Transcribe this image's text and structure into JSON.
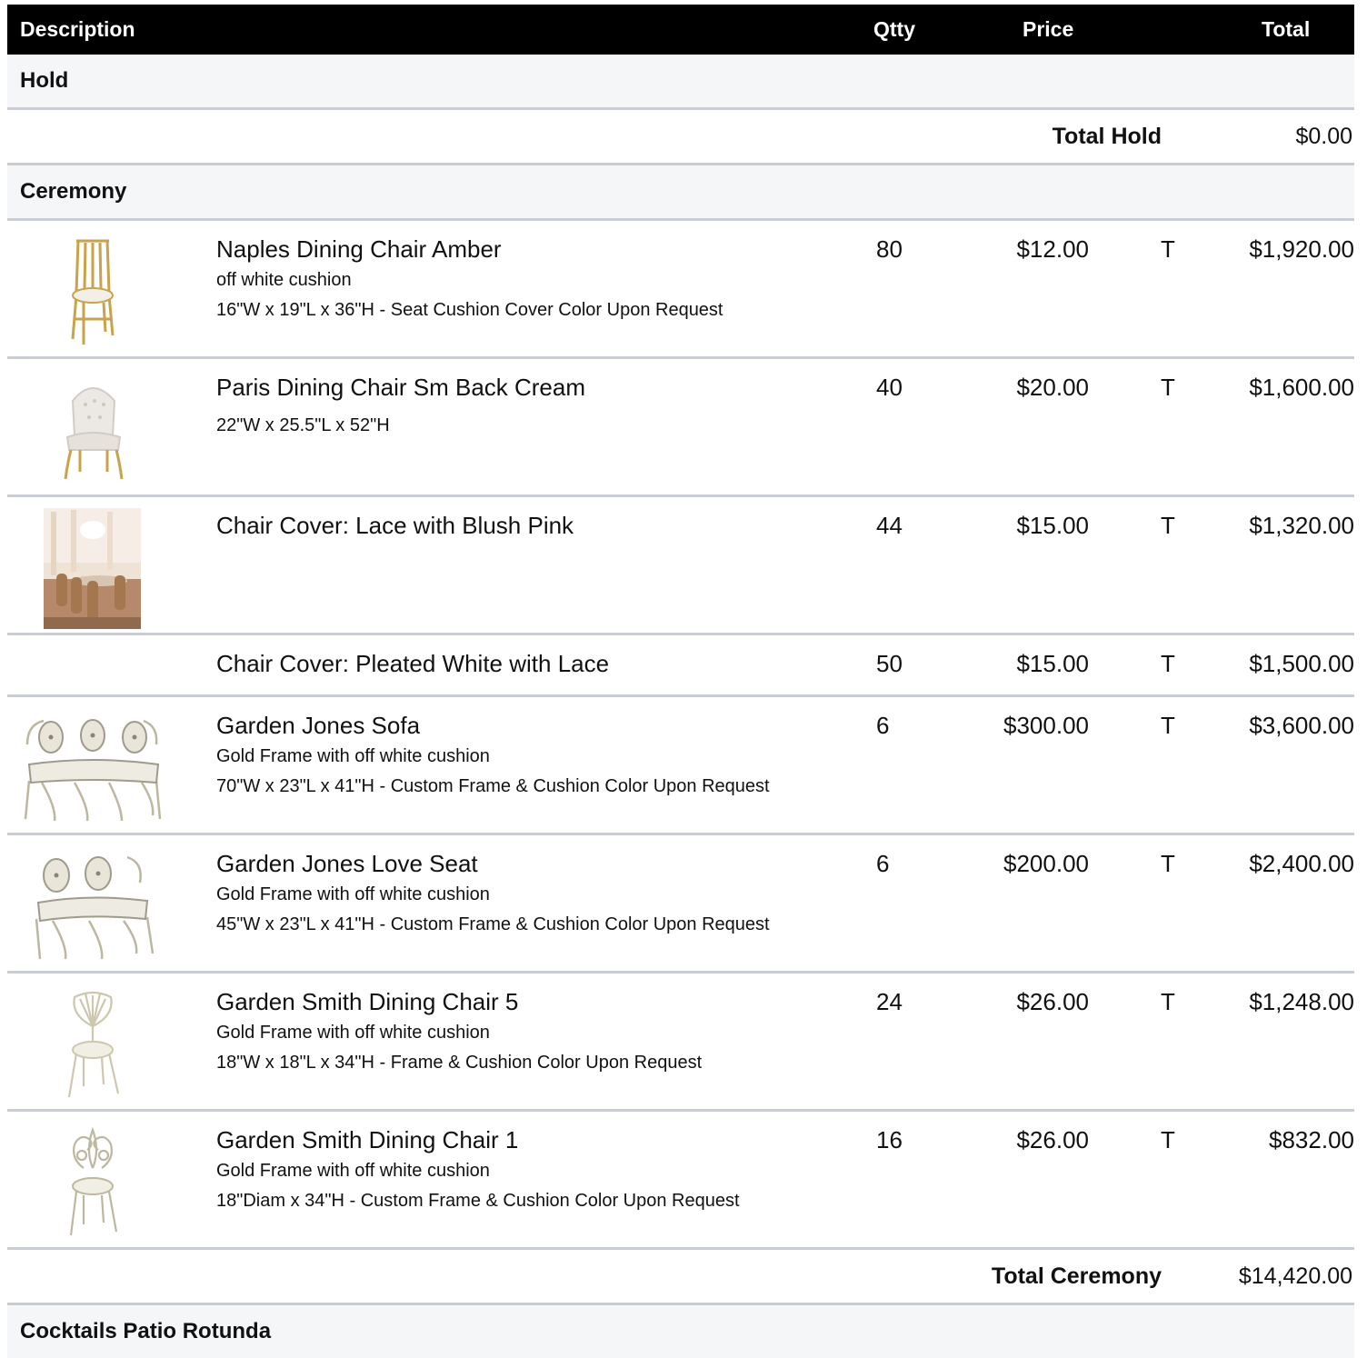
{
  "header": {
    "description": "Description",
    "qty": "Qtty",
    "price": "Price",
    "total": "Total"
  },
  "sections": {
    "hold": {
      "name": "Hold",
      "total_label": "Total Hold",
      "total_value": "$0.00"
    },
    "ceremony": {
      "name": "Ceremony",
      "total_label": "Total Ceremony",
      "total_value": "$14,420.00",
      "items": [
        {
          "name": "Naples Dining Chair Amber",
          "line1": "off white cushion",
          "line2": "16\"W x 19\"L x 36\"H -  Seat Cushion Cover Color Upon Request",
          "qty": "80",
          "price": "$12.00",
          "tax": "T",
          "total": "$1,920.00",
          "image_icon": "gold-chiavari-chair-icon"
        },
        {
          "name": "Paris Dining Chair Sm Back Cream",
          "line1": "22\"W x 25.5\"L x 52\"H",
          "qty": "40",
          "price": "$20.00",
          "tax": "T",
          "total": "$1,600.00",
          "image_icon": "tufted-cream-chair-icon"
        },
        {
          "name": "Chair Cover: Lace with Blush Pink",
          "qty": "44",
          "price": "$15.00",
          "tax": "T",
          "total": "$1,320.00",
          "image_icon": "event-room-photo-icon"
        },
        {
          "name": "Chair Cover: Pleated White with Lace",
          "qty": "50",
          "price": "$15.00",
          "tax": "T",
          "total": "$1,500.00"
        },
        {
          "name": "Garden Jones Sofa",
          "line1": "Gold Frame with off white cushion",
          "line2": "70\"W x 23\"L x 41\"H - Custom Frame & Cushion Color Upon Request",
          "qty": "6",
          "price": "$300.00",
          "tax": "T",
          "total": "$3,600.00",
          "image_icon": "garden-sofa-icon"
        },
        {
          "name": "Garden Jones Love Seat",
          "line1": "Gold Frame with off white cushion",
          "line2": "45\"W x 23\"L x 41\"H - Custom Frame & Cushion Color Upon Request",
          "qty": "6",
          "price": "$200.00",
          "tax": "T",
          "total": "$2,400.00",
          "image_icon": "garden-love-seat-icon"
        },
        {
          "name": "Garden Smith Dining Chair 5",
          "line1": "Gold Frame with off white cushion",
          "line2": "18\"W x 18\"L x 34\"H - Frame & Cushion Color Upon Request",
          "qty": "24",
          "price": "$26.00",
          "tax": "T",
          "total": "$1,248.00",
          "image_icon": "shell-back-chair-icon"
        },
        {
          "name": "Garden Smith Dining Chair 1",
          "line1": "Gold Frame with off white cushion",
          "line2": "18\"Diam x 34\"H - Custom Frame & Cushion Color Upon Request",
          "qty": "16",
          "price": "$26.00",
          "tax": "T",
          "total": "$832.00",
          "image_icon": "scroll-back-chair-icon"
        }
      ]
    },
    "cocktails": {
      "name": "Cocktails Patio Rotunda"
    }
  },
  "colors": {
    "header_bg": "#000000",
    "section_bg": "#f4f6f8",
    "divider": "#c9cdd1",
    "frame_cream": "#e9e4cf",
    "gold": "#c9a24a"
  }
}
